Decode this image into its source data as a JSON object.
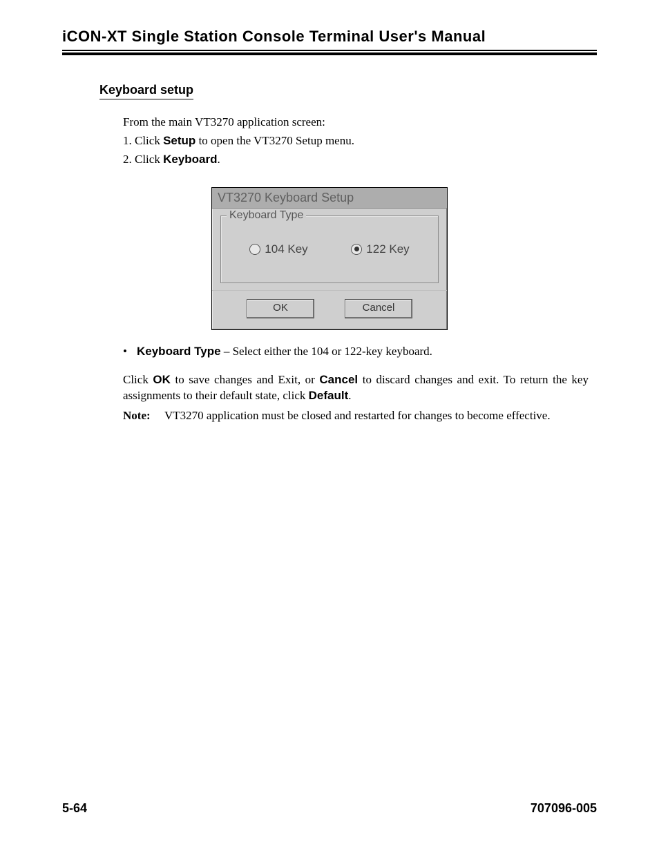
{
  "header": {
    "running_head": "iCON-XT Single Station Console Terminal User's Manual"
  },
  "section": {
    "heading": "Keyboard setup",
    "intro": "From the main VT3270 application screen:",
    "step1_prefix": "1. Click ",
    "step1_bold": "Setup",
    "step1_suffix": " to open the VT3270 Setup menu.",
    "step2_prefix": "2. Click ",
    "step2_bold": "Keyboard",
    "step2_suffix": "."
  },
  "dialog": {
    "title": "VT3270 Keyboard Setup",
    "group_label": "Keyboard Type",
    "radio1_label": "104 Key",
    "radio2_label": "122 Key",
    "ok_label": "OK",
    "cancel_label": "Cancel"
  },
  "bullet": {
    "dot": "•",
    "bold": "Keyboard Type",
    "rest": " – Select either the 104 or 122-key keyboard."
  },
  "para": {
    "p1a": "Click ",
    "p1b": "OK",
    "p1c": " to save changes and Exit, or ",
    "p1d": "Cancel",
    "p1e": " to discard changes and exit.  To return the key assignments to their default state, click ",
    "p1f": "Default",
    "p1g": "."
  },
  "note": {
    "label": "Note:",
    "text": "VT3270 application must be closed and restarted for changes to become effective."
  },
  "footer": {
    "page_num": "5-64",
    "doc_num": "707096-005"
  }
}
